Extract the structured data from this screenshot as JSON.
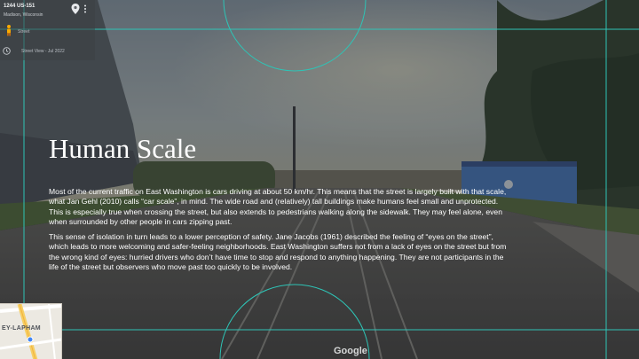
{
  "streetview": {
    "address": "1244 US-151",
    "city": "Madison, Wisconsin",
    "walk_label": "Street",
    "capture_date": "Street View - Jul 2022",
    "pin_icon": "location-pin-icon",
    "more_icon": "more-vert-icon",
    "time_icon": "clock-icon",
    "pegman_icon": "pegman-icon"
  },
  "minimap": {
    "label": "EY-LAPHAM"
  },
  "watermark": "Google",
  "slide": {
    "title": "Human Scale",
    "paragraphs": [
      "Most of the current traffic on East Washington is cars driving at about 50 km/hr. This means that the street is largely built with that scale, what Jan Gehl (2010) calls “car scale”, in mind. The wide road and (relatively) tall buildings make humans feel small and unprotected. This is especially true when crossing the street, but also extends to pedestrians walking along the sidewalk. They may feel alone, even when surrounded by other people in cars zipping past.",
      "This sense of isolation in turn leads to a lower perception of safety. Jane Jacobs (1961) described the feeling of “eyes on the street”, which leads to more welcoming and safer-feeling neighborhoods. East Washington suffers not from a lack of eyes on the street but from the wrong kind of eyes: hurried drivers who don’t have time to stop and respond to anything happening. They are not participants in the life of the street but observers who move past too quickly to be involved."
    ]
  },
  "colors": {
    "accent": "#2ec4b6",
    "text": "#ffffff",
    "sky": "#7b8a96",
    "road": "#5a5650"
  }
}
